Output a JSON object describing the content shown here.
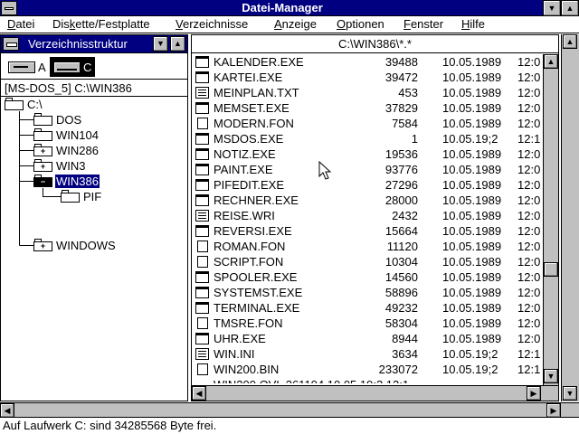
{
  "window": {
    "title": "Datei-Manager"
  },
  "menu": {
    "items": [
      {
        "label": "Datei",
        "accel": "D",
        "rest": "atei"
      },
      {
        "label": "Diskette/Festplatte",
        "accel": "k",
        "pre": "Dis",
        "rest": "ette/Festplatte"
      },
      {
        "label": "Verzeichnisse",
        "accel": "V",
        "rest": "erzeichnisse"
      },
      {
        "label": "Anzeige",
        "accel": "A",
        "rest": "nzeige"
      },
      {
        "label": "Optionen",
        "accel": "O",
        "rest": "ptionen"
      },
      {
        "label": "Fenster",
        "accel": "F",
        "rest": "enster"
      },
      {
        "label": "Hilfe",
        "accel": "H",
        "rest": "ilfe"
      }
    ]
  },
  "tree_panel": {
    "title": "Verzeichnisstruktur",
    "drives": [
      {
        "letter": "A",
        "type": "floppy"
      },
      {
        "letter": "C",
        "type": "harddisk",
        "selected": true
      }
    ],
    "volume": "[MS-DOS_5]  C:\\WIN386",
    "nodes": [
      {
        "label": "C:\\",
        "level": 0,
        "sign": ""
      },
      {
        "label": "DOS",
        "level": 1,
        "sign": ""
      },
      {
        "label": "WIN104",
        "level": 1,
        "sign": ""
      },
      {
        "label": "WIN286",
        "level": 1,
        "sign": "+"
      },
      {
        "label": "WIN3",
        "level": 1,
        "sign": "+"
      },
      {
        "label": "WIN386",
        "level": 1,
        "sign": "−",
        "selected": true
      },
      {
        "label": "PIF",
        "level": 2,
        "sign": ""
      },
      {
        "label": "WINDOWS",
        "level": 1,
        "sign": "+"
      }
    ]
  },
  "file_panel": {
    "path": "C:\\WIN386\\*.*",
    "files": [
      {
        "name": "KALENDER.EXE",
        "size": "39488",
        "date": "10.05.1989",
        "time": "12:0",
        "icon": "exe"
      },
      {
        "name": "KARTEI.EXE",
        "size": "39472",
        "date": "10.05.1989",
        "time": "12:0",
        "icon": "exe"
      },
      {
        "name": "MEINPLAN.TXT",
        "size": "453",
        "date": "10.05.1989",
        "time": "12:0",
        "icon": "doc"
      },
      {
        "name": "MEMSET.EXE",
        "size": "37829",
        "date": "10.05.1989",
        "time": "12:0",
        "icon": "exe"
      },
      {
        "name": "MODERN.FON",
        "size": "7584",
        "date": "10.05.1989",
        "time": "12:0",
        "icon": "plain"
      },
      {
        "name": "MSDOS.EXE",
        "size": "1",
        "date": "10.05.19;2",
        "time": "12:1",
        "icon": "exe"
      },
      {
        "name": "NOTIZ.EXE",
        "size": "19536",
        "date": "10.05.1989",
        "time": "12:0",
        "icon": "exe"
      },
      {
        "name": "PAINT.EXE",
        "size": "93776",
        "date": "10.05.1989",
        "time": "12:0",
        "icon": "exe"
      },
      {
        "name": "PIFEDIT.EXE",
        "size": "27296",
        "date": "10.05.1989",
        "time": "12:0",
        "icon": "exe"
      },
      {
        "name": "RECHNER.EXE",
        "size": "28000",
        "date": "10.05.1989",
        "time": "12:0",
        "icon": "exe"
      },
      {
        "name": "REISE.WRI",
        "size": "2432",
        "date": "10.05.1989",
        "time": "12:0",
        "icon": "doc"
      },
      {
        "name": "REVERSI.EXE",
        "size": "15664",
        "date": "10.05.1989",
        "time": "12:0",
        "icon": "exe"
      },
      {
        "name": "ROMAN.FON",
        "size": "11120",
        "date": "10.05.1989",
        "time": "12:0",
        "icon": "plain"
      },
      {
        "name": "SCRIPT.FON",
        "size": "10304",
        "date": "10.05.1989",
        "time": "12:0",
        "icon": "plain"
      },
      {
        "name": "SPOOLER.EXE",
        "size": "14560",
        "date": "10.05.1989",
        "time": "12:0",
        "icon": "exe"
      },
      {
        "name": "SYSTEMST.EXE",
        "size": "58896",
        "date": "10.05.1989",
        "time": "12:0",
        "icon": "exe"
      },
      {
        "name": "TERMINAL.EXE",
        "size": "49232",
        "date": "10.05.1989",
        "time": "12:0",
        "icon": "exe"
      },
      {
        "name": "TMSRE.FON",
        "size": "58304",
        "date": "10.05.1989",
        "time": "12:0",
        "icon": "plain"
      },
      {
        "name": "UHR.EXE",
        "size": "8944",
        "date": "10.05.1989",
        "time": "12:0",
        "icon": "exe"
      },
      {
        "name": "WIN.INI",
        "size": "3634",
        "date": "10.05.19;2",
        "time": "12:1",
        "icon": "doc"
      },
      {
        "name": "WIN200.BIN",
        "size": "233072",
        "date": "10.05.19;2",
        "time": "12:1",
        "icon": "plain"
      }
    ],
    "partial_row": "WIN200.OVL   261104   10.05.19;2   12:1"
  },
  "status": {
    "text": "Auf Laufwerk C: sind 34285568 Byte frei."
  },
  "colors": {
    "titlebar": "#000080",
    "chrome": "#c0c0c0",
    "selection": "#000080"
  }
}
